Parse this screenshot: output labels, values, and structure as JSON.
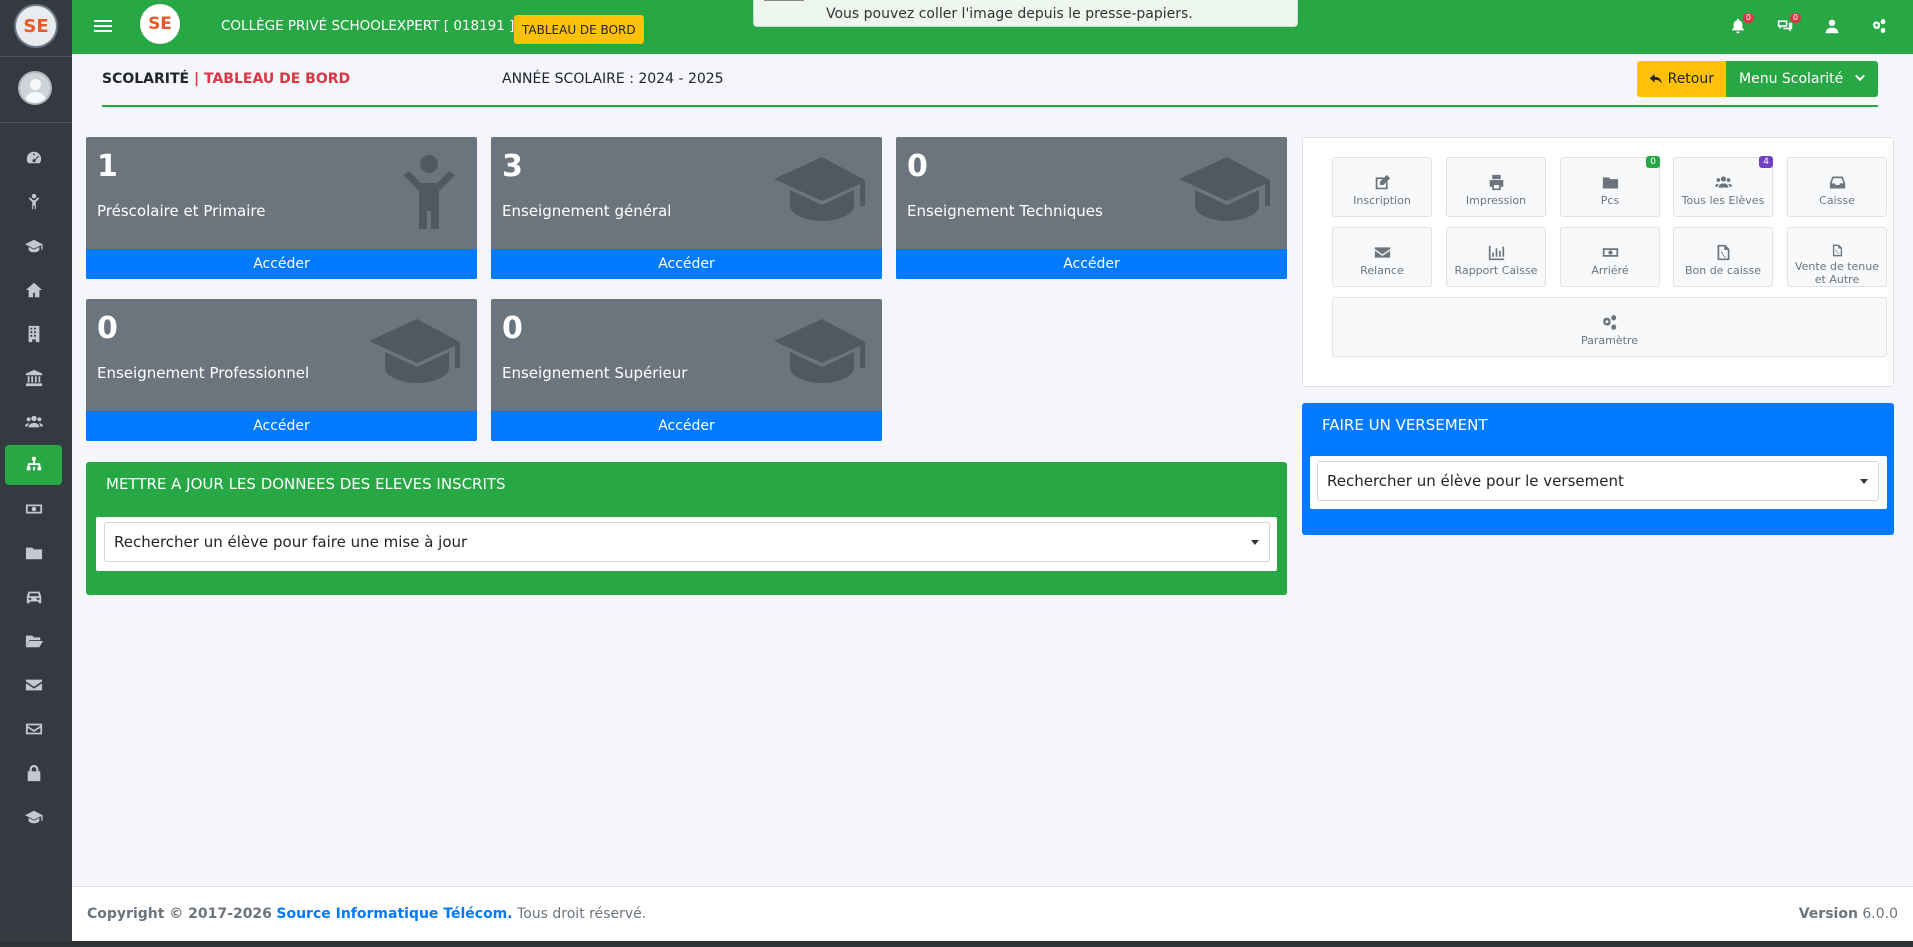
{
  "brand": {
    "logo_text": "SE"
  },
  "topbar": {
    "school": "COLLÈGE PRIVÉ SCHOOLEXPERT [ 018191 ] |",
    "dashboard_badge": "TABLEAU DE BORD",
    "notif_count": "0",
    "msg_count": "0"
  },
  "toast": {
    "text": "Vous pouvez coller l'image depuis le presse-papiers."
  },
  "header": {
    "section": "SCOLARITÉ",
    "separator": "|",
    "subtitle": "TABLEAU DE BORD",
    "school_year": "ANNÉE SCOLAIRE : 2024 - 2025",
    "back_button": "Retour",
    "menu_button": "Menu Scolarité"
  },
  "cards": [
    {
      "count": "1",
      "label": "Préscolaire et Primaire",
      "action": "Accéder",
      "icon": "child-icon"
    },
    {
      "count": "3",
      "label": "Enseignement général",
      "action": "Accéder",
      "icon": "graduation-cap-icon"
    },
    {
      "count": "0",
      "label": "Enseignement Techniques",
      "action": "Accéder",
      "icon": "graduation-cap-icon"
    },
    {
      "count": "0",
      "label": "Enseignement Professionnel",
      "action": "Accéder",
      "icon": "graduation-cap-icon"
    },
    {
      "count": "0",
      "label": "Enseignement Supérieur",
      "action": "Accéder",
      "icon": "graduation-cap-icon"
    }
  ],
  "update_panel": {
    "title": "METTRE A JOUR LES DONNEES DES ELEVES INSCRITS",
    "select_placeholder": "Rechercher un élève pour faire une mise à jour"
  },
  "quick_actions": [
    {
      "label": "Inscription",
      "icon": "edit-icon"
    },
    {
      "label": "Impression",
      "icon": "print-icon"
    },
    {
      "label": "Pcs",
      "icon": "folder-icon",
      "badge": "0"
    },
    {
      "label": "Tous les Elèves",
      "icon": "users-icon",
      "badge": "4"
    },
    {
      "label": "Caisse",
      "icon": "inbox-icon"
    },
    {
      "label": "Relance",
      "icon": "envelope-icon"
    },
    {
      "label": "Rapport Caisse",
      "icon": "bar-chart-icon"
    },
    {
      "label": "Arriéré",
      "icon": "money-icon"
    },
    {
      "label": "Bon de caisse",
      "icon": "pdf-icon"
    },
    {
      "label": "Vente de tenue et Autre",
      "icon": "pdf-icon"
    },
    {
      "label": "Paramètre",
      "icon": "cogs-icon"
    }
  ],
  "payment_panel": {
    "title": "FAIRE UN VERSEMENT",
    "select_placeholder": "Rechercher un élève pour le versement"
  },
  "footer": {
    "copyright": "Copyright © 2017-2026",
    "company": "Source Informatique Télécom.",
    "rights": "Tous droit réservé.",
    "version_label": "Version",
    "version": "6.0.0"
  },
  "colors": {
    "primary_green": "#28a745",
    "primary_blue": "#007bff",
    "warning": "#ffc107",
    "card_gray": "#6c757d",
    "sidebar": "#343a40"
  }
}
